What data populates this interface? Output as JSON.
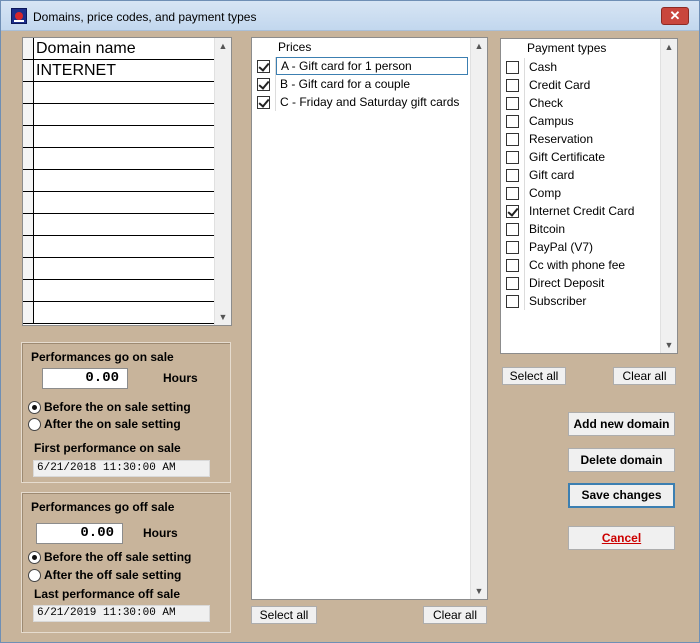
{
  "window": {
    "title": "Domains, price codes, and payment types",
    "close_label": "✕"
  },
  "domains": {
    "header": "Domain name",
    "rows": [
      "INTERNET",
      "",
      "",
      "",
      "",
      "",
      "",
      "",
      "",
      "",
      "",
      ""
    ]
  },
  "on_sale": {
    "title": "Performances go on sale",
    "hours_value": "0.00",
    "hours_label": "Hours",
    "radio_before": "Before the on sale setting",
    "radio_after": "After the on sale setting",
    "selected": "before",
    "first_label": "First performance on sale",
    "first_value": "6/21/2018 11:30:00 AM"
  },
  "off_sale": {
    "title": "Performances go off sale",
    "hours_value": "0.00",
    "hours_label": "Hours",
    "radio_before": "Before the off sale setting",
    "radio_after": "After the off sale setting",
    "selected": "before",
    "last_label": "Last performance off sale",
    "last_value": "6/21/2019 11:30:00 AM"
  },
  "prices": {
    "header": "Prices",
    "items": [
      {
        "label": "A - Gift card for 1 person",
        "checked": true
      },
      {
        "label": "B - Gift card for a couple",
        "checked": true
      },
      {
        "label": "C - Friday and Saturday gift cards",
        "checked": true
      }
    ],
    "select_all": "Select all",
    "clear_all": "Clear all"
  },
  "payments": {
    "header": "Payment types",
    "items": [
      {
        "label": "Cash",
        "checked": false
      },
      {
        "label": "Credit Card",
        "checked": false
      },
      {
        "label": "Check",
        "checked": false
      },
      {
        "label": "Campus",
        "checked": false
      },
      {
        "label": "Reservation",
        "checked": false
      },
      {
        "label": "Gift Certificate",
        "checked": false
      },
      {
        "label": "Gift card",
        "checked": false
      },
      {
        "label": "Comp",
        "checked": false
      },
      {
        "label": "Internet Credit Card",
        "checked": true
      },
      {
        "label": "Bitcoin",
        "checked": false
      },
      {
        "label": "PayPal (V7)",
        "checked": false
      },
      {
        "label": "Cc with phone fee",
        "checked": false
      },
      {
        "label": "Direct Deposit",
        "checked": false
      },
      {
        "label": "Subscriber",
        "checked": false
      }
    ],
    "select_all": "Select all",
    "clear_all": "Clear all"
  },
  "actions": {
    "add": "Add new domain",
    "delete": "Delete domain",
    "save": "Save changes",
    "cancel": "Cancel"
  },
  "colors": {
    "window_bg": "#c8b49b",
    "cancel_text": "#cc0000",
    "focus_border": "#3c7fb1"
  },
  "icons": {
    "checkbox_checked": "check-mark",
    "radio_selected": "filled-dot",
    "scroll_up": "chevron-up",
    "scroll_down": "chevron-down"
  }
}
